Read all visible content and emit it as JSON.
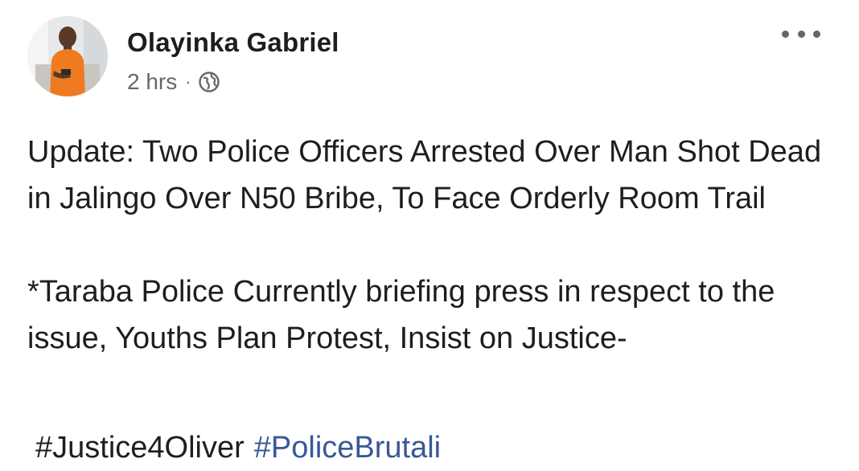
{
  "post": {
    "author": "Olayinka Gabriel",
    "time": "2 hrs",
    "separator": "·",
    "audience_icon": "globe-icon",
    "menu_icon": "more-horizontal-icon",
    "paragraph1": "Update: Two Police Officers Arrested Over Man Shot Dead in Jalingo Over N50 Bribe, To Face Orderly Room Trail",
    "paragraph2": "*Taraba Police Currently briefing press in respect to the issue, Youths Plan Protest, Insist on Justice-",
    "hashtag1": "#Justice4Oliver",
    "hashtag2": "#PoliceBrutali"
  },
  "colors": {
    "text": "#1c1e21",
    "secondary": "#65676b",
    "link": "#385898",
    "avatar_shirt": "#f07a1f"
  }
}
